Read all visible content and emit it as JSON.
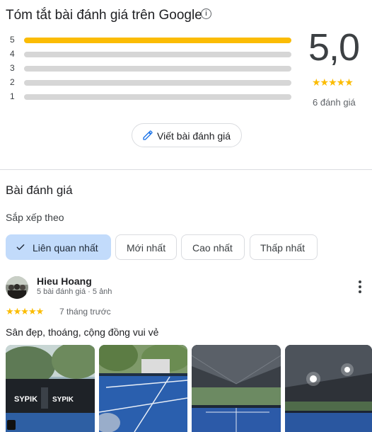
{
  "summary": {
    "title": "Tóm tắt bài đánh giá trên Google",
    "info_icon": "info-icon",
    "score": "5,0",
    "stars": "★★★★★",
    "review_count": "6 đánh giá",
    "distribution": [
      {
        "star": "5",
        "fraction": 1.0
      },
      {
        "star": "4",
        "fraction": 0
      },
      {
        "star": "3",
        "fraction": 0
      },
      {
        "star": "2",
        "fraction": 0
      },
      {
        "star": "1",
        "fraction": 0
      }
    ],
    "write_review_label": "Viết bài đánh giá",
    "bar_color": "#fbbc04"
  },
  "reviews_section": {
    "title": "Bài đánh giá",
    "sort_label": "Sắp xếp theo",
    "sort_options": [
      "Liên quan nhất",
      "Mới nhất",
      "Cao nhất",
      "Thấp nhất"
    ],
    "active_sort": "Liên quan nhất"
  },
  "review": {
    "name": "Hieu Hoang",
    "meta": "5 bài đánh giá · 5 ảnh",
    "stars": "★★★★★",
    "time": "7 tháng trước",
    "text": "Sân đẹp, thoáng, cộng đồng vui vẻ",
    "photo_sign_text": "SYPIK"
  }
}
